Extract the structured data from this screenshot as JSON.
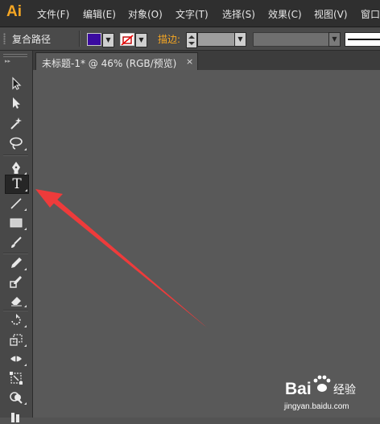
{
  "app": {
    "logo_text": "Ai"
  },
  "menu": {
    "items": [
      {
        "label": "文件(F)"
      },
      {
        "label": "编辑(E)"
      },
      {
        "label": "对象(O)"
      },
      {
        "label": "文字(T)"
      },
      {
        "label": "选择(S)"
      },
      {
        "label": "效果(C)"
      },
      {
        "label": "视图(V)"
      },
      {
        "label": "窗口"
      }
    ]
  },
  "control_bar": {
    "selection_label": "复合路径",
    "fill_color": "#3a0aa0",
    "stroke_label": "描边:",
    "stroke_weight_value": "",
    "stroke_color": "none"
  },
  "document_tab": {
    "title": "未标题-1* @ 46% (RGB/预览)",
    "close_glyph": "×"
  },
  "tools": [
    {
      "name": "selection-tool-icon"
    },
    {
      "name": "direct-selection-tool-icon"
    },
    {
      "name": "magic-wand-tool-icon"
    },
    {
      "name": "lasso-tool-icon"
    },
    {
      "name": "pen-tool-icon"
    },
    {
      "name": "type-tool-icon",
      "glyph": "T",
      "active": true
    },
    {
      "name": "line-segment-tool-icon"
    },
    {
      "name": "rectangle-tool-icon"
    },
    {
      "name": "paintbrush-tool-icon"
    },
    {
      "name": "pencil-tool-icon"
    },
    {
      "name": "blob-brush-tool-icon"
    },
    {
      "name": "eraser-tool-icon"
    },
    {
      "name": "rotate-tool-icon"
    },
    {
      "name": "scale-tool-icon"
    },
    {
      "name": "width-tool-icon"
    },
    {
      "name": "free-transform-tool-icon"
    },
    {
      "name": "shape-builder-tool-icon"
    },
    {
      "name": "perspective-grid-tool-icon"
    }
  ],
  "annotation": {
    "color": "#ee3b3b"
  },
  "watermark": {
    "brand_text": "Bai",
    "brand_suffix": "经验",
    "url": "jingyan.baidu.com"
  }
}
